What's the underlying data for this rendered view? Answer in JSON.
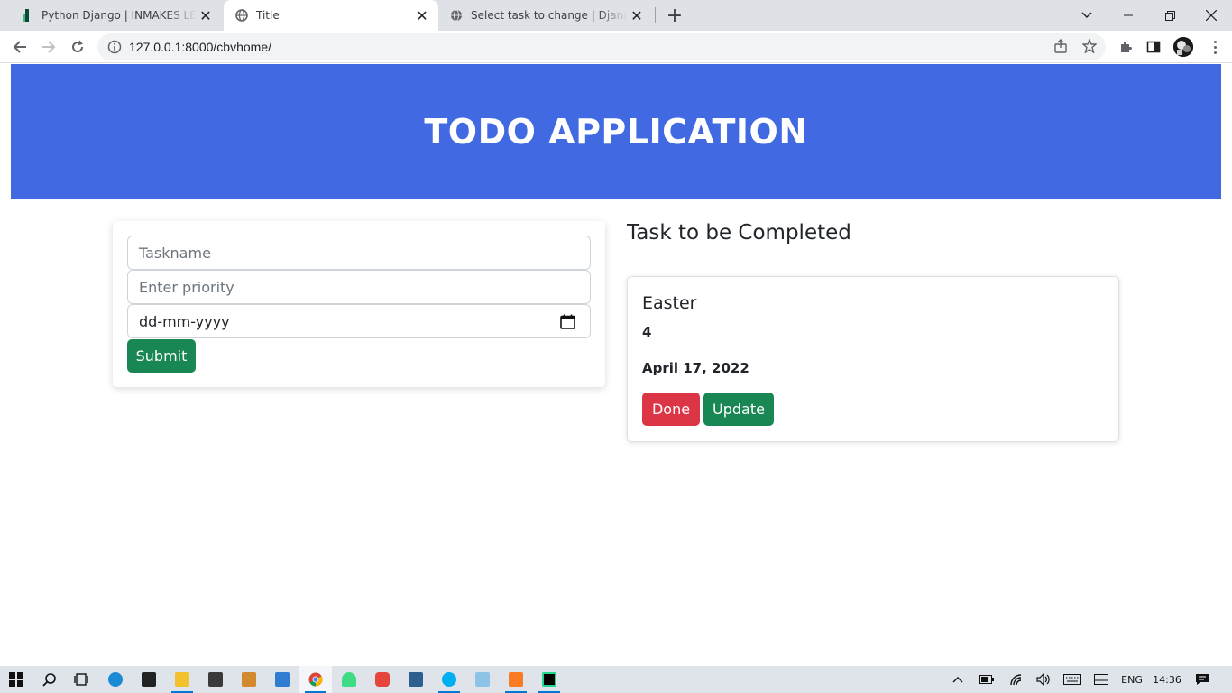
{
  "browser": {
    "tabs": [
      {
        "title": "Python Django | INMAKES LEARN",
        "active": false
      },
      {
        "title": "Title",
        "active": true
      },
      {
        "title": "Select task to change | Django sit",
        "active": false
      }
    ],
    "url": "127.0.0.1:8000/cbvhome/"
  },
  "page": {
    "header_title": "TODO APPLICATION",
    "form": {
      "taskname_placeholder": "Taskname",
      "priority_placeholder": "Enter priority",
      "date_value": "dd-mm-yyyy",
      "submit_label": "Submit"
    },
    "task_section_title": "Task to be Completed",
    "tasks": [
      {
        "name": "Easter",
        "priority": "4",
        "date": "April 17, 2022",
        "done_label": "Done",
        "update_label": "Update"
      }
    ]
  },
  "taskbar": {
    "language": "ENG",
    "time": "14:36"
  },
  "colors": {
    "header_bg": "#4169e1",
    "success": "#198754",
    "danger": "#dc3545",
    "tabstrip": "#dee1e6"
  },
  "icons": [
    "django-favicon",
    "globe-icon",
    "close-icon",
    "plus-icon",
    "chevron-down-icon",
    "minimize-icon",
    "restore-icon",
    "back-arrow-icon",
    "forward-arrow-icon",
    "reload-icon",
    "info-icon",
    "share-icon",
    "star-icon",
    "puzzle-icon",
    "sidepanel-icon",
    "calendar-icon",
    "windows-start-icon",
    "search-icon",
    "taskview-icon"
  ]
}
